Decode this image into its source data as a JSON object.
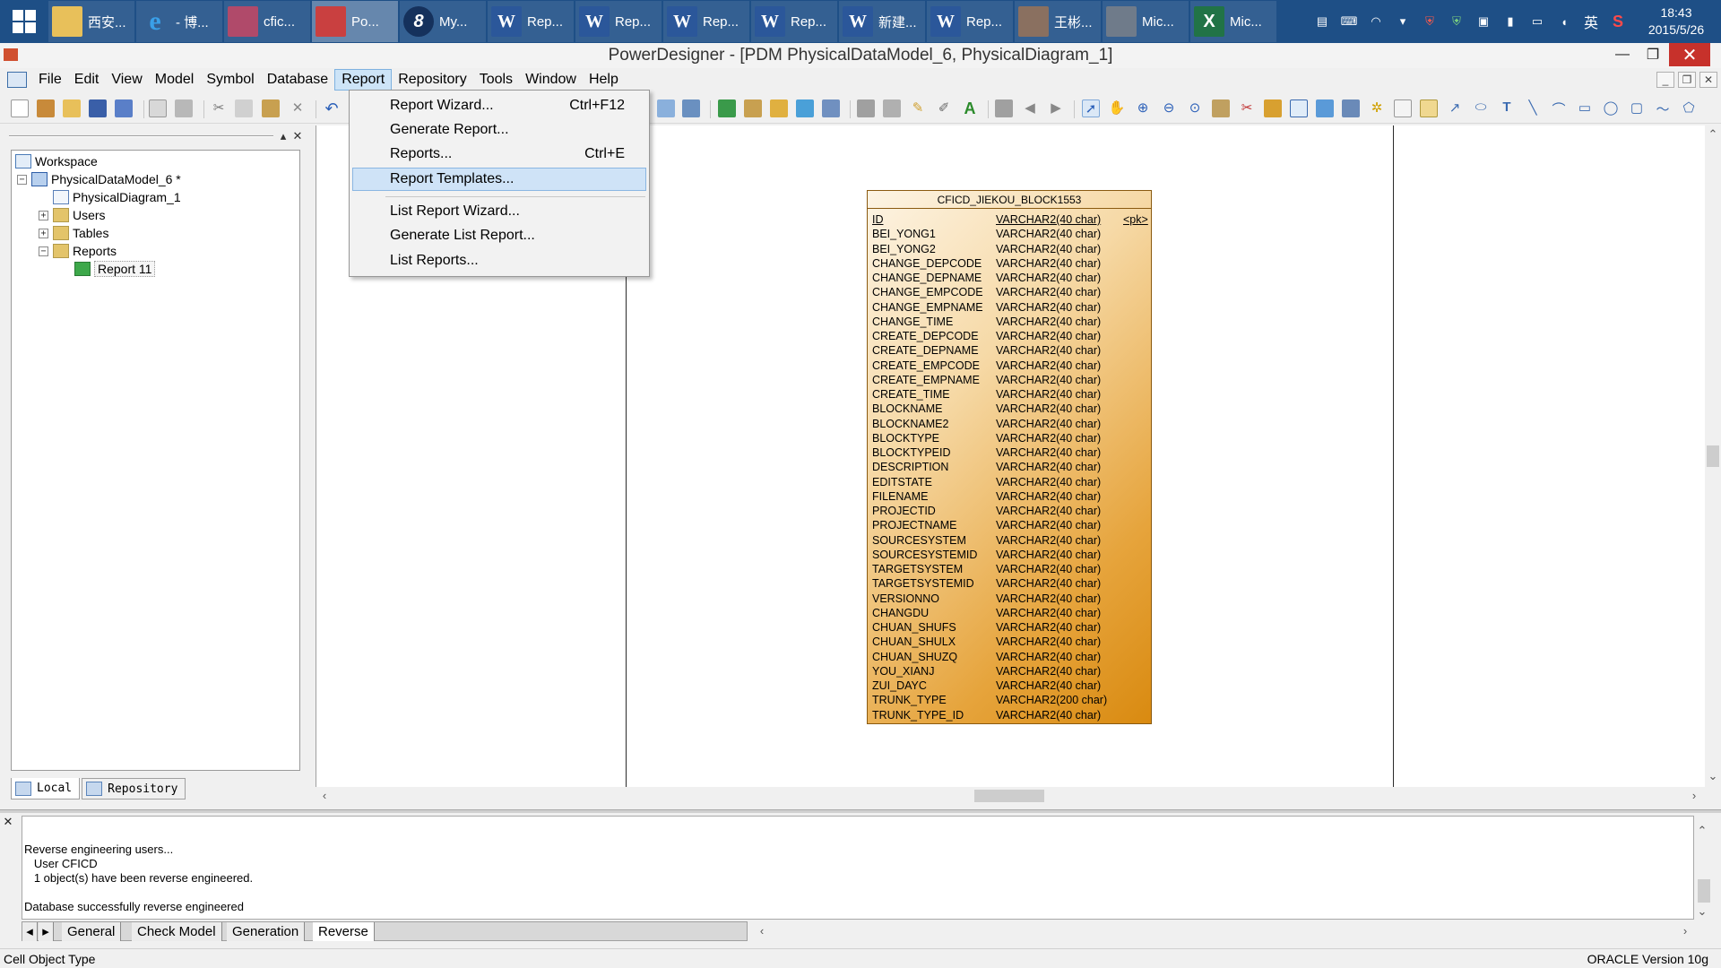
{
  "taskbar": {
    "buttons": [
      {
        "label": "西安...",
        "icon": "folder-icon"
      },
      {
        "label": "- 博...",
        "icon": "ie-icon"
      },
      {
        "label": "cfic...",
        "icon": "database-icon"
      },
      {
        "label": "Po...",
        "icon": "powerdesigner-icon"
      },
      {
        "label": "My...",
        "icon": "myeclipse-icon"
      },
      {
        "label": "Rep...",
        "icon": "word-icon"
      },
      {
        "label": "Rep...",
        "icon": "word-icon"
      },
      {
        "label": "Rep...",
        "icon": "word-icon"
      },
      {
        "label": "Rep...",
        "icon": "word-icon"
      },
      {
        "label": "新建...",
        "icon": "word-icon"
      },
      {
        "label": "Rep...",
        "icon": "word-icon"
      },
      {
        "label": "王彬...",
        "icon": "person-icon"
      },
      {
        "label": "Mic...",
        "icon": "window-icon"
      },
      {
        "label": "Mic...",
        "icon": "excel-icon"
      }
    ],
    "tray": {
      "ime": "英",
      "time": "18:43",
      "date": "2015/5/26"
    }
  },
  "window": {
    "title": "PowerDesigner - [PDM PhysicalDataModel_6, PhysicalDiagram_1]"
  },
  "menubar": {
    "items": [
      "File",
      "Edit",
      "View",
      "Model",
      "Symbol",
      "Database",
      "Report",
      "Repository",
      "Tools",
      "Window",
      "Help"
    ],
    "open_item": "Report"
  },
  "report_menu": {
    "items": [
      {
        "label": "Report Wizard...",
        "shortcut": "Ctrl+F12"
      },
      {
        "label": "Generate Report...",
        "shortcut": ""
      },
      {
        "label": "Reports...",
        "shortcut": "Ctrl+E"
      },
      {
        "label": "Report Templates...",
        "shortcut": ""
      },
      {
        "label": "List Report Wizard...",
        "shortcut": ""
      },
      {
        "label": "Generate List Report...",
        "shortcut": ""
      },
      {
        "label": "List Reports...",
        "shortcut": ""
      }
    ],
    "highlighted": "Report Templates..."
  },
  "browser": {
    "workspace": "Workspace",
    "model": "PhysicalDataModel_6 *",
    "diagram": "PhysicalDiagram_1",
    "users": "Users",
    "tables": "Tables",
    "reports": "Reports",
    "report": "Report 11",
    "tabs": {
      "local": "Local",
      "repository": "Repository"
    }
  },
  "entity": {
    "name": "CFICD_JIEKOU_BLOCK1553",
    "columns": [
      {
        "name": "ID",
        "type": "VARCHAR2(40 char)",
        "key": "<pk>"
      },
      {
        "name": "BEI_YONG1",
        "type": "VARCHAR2(40 char)",
        "key": ""
      },
      {
        "name": "BEI_YONG2",
        "type": "VARCHAR2(40 char)",
        "key": ""
      },
      {
        "name": "CHANGE_DEPCODE",
        "type": "VARCHAR2(40 char)",
        "key": ""
      },
      {
        "name": "CHANGE_DEPNAME",
        "type": "VARCHAR2(40 char)",
        "key": ""
      },
      {
        "name": "CHANGE_EMPCODE",
        "type": "VARCHAR2(40 char)",
        "key": ""
      },
      {
        "name": "CHANGE_EMPNAME",
        "type": "VARCHAR2(40 char)",
        "key": ""
      },
      {
        "name": "CHANGE_TIME",
        "type": "VARCHAR2(40 char)",
        "key": ""
      },
      {
        "name": "CREATE_DEPCODE",
        "type": "VARCHAR2(40 char)",
        "key": ""
      },
      {
        "name": "CREATE_DEPNAME",
        "type": "VARCHAR2(40 char)",
        "key": ""
      },
      {
        "name": "CREATE_EMPCODE",
        "type": "VARCHAR2(40 char)",
        "key": ""
      },
      {
        "name": "CREATE_EMPNAME",
        "type": "VARCHAR2(40 char)",
        "key": ""
      },
      {
        "name": "CREATE_TIME",
        "type": "VARCHAR2(40 char)",
        "key": ""
      },
      {
        "name": "BLOCKNAME",
        "type": "VARCHAR2(40 char)",
        "key": ""
      },
      {
        "name": "BLOCKNAME2",
        "type": "VARCHAR2(40 char)",
        "key": ""
      },
      {
        "name": "BLOCKTYPE",
        "type": "VARCHAR2(40 char)",
        "key": ""
      },
      {
        "name": "BLOCKTYPEID",
        "type": "VARCHAR2(40 char)",
        "key": ""
      },
      {
        "name": "DESCRIPTION",
        "type": "VARCHAR2(40 char)",
        "key": ""
      },
      {
        "name": "EDITSTATE",
        "type": "VARCHAR2(40 char)",
        "key": ""
      },
      {
        "name": "FILENAME",
        "type": "VARCHAR2(40 char)",
        "key": ""
      },
      {
        "name": "PROJECTID",
        "type": "VARCHAR2(40 char)",
        "key": ""
      },
      {
        "name": "PROJECTNAME",
        "type": "VARCHAR2(40 char)",
        "key": ""
      },
      {
        "name": "SOURCESYSTEM",
        "type": "VARCHAR2(40 char)",
        "key": ""
      },
      {
        "name": "SOURCESYSTEMID",
        "type": "VARCHAR2(40 char)",
        "key": ""
      },
      {
        "name": "TARGETSYSTEM",
        "type": "VARCHAR2(40 char)",
        "key": ""
      },
      {
        "name": "TARGETSYSTEMID",
        "type": "VARCHAR2(40 char)",
        "key": ""
      },
      {
        "name": "VERSIONNO",
        "type": "VARCHAR2(40 char)",
        "key": ""
      },
      {
        "name": "CHANGDU",
        "type": "VARCHAR2(40 char)",
        "key": ""
      },
      {
        "name": "CHUAN_SHUFS",
        "type": "VARCHAR2(40 char)",
        "key": ""
      },
      {
        "name": "CHUAN_SHULX",
        "type": "VARCHAR2(40 char)",
        "key": ""
      },
      {
        "name": "CHUAN_SHUZQ",
        "type": "VARCHAR2(40 char)",
        "key": ""
      },
      {
        "name": "YOU_XIANJ",
        "type": "VARCHAR2(40 char)",
        "key": ""
      },
      {
        "name": "ZUI_DAYC",
        "type": "VARCHAR2(40 char)",
        "key": ""
      },
      {
        "name": "TRUNK_TYPE",
        "type": "VARCHAR2(200 char)",
        "key": ""
      },
      {
        "name": "TRUNK_TYPE_ID",
        "type": "VARCHAR2(40 char)",
        "key": ""
      }
    ]
  },
  "output": {
    "lines": [
      "Reverse engineering users...",
      "   User CFICD",
      "   1 object(s) have been reverse engineered.",
      "",
      "Database successfully reverse engineered"
    ],
    "tabs": [
      "General",
      "Check Model",
      "Generation",
      "Reverse"
    ],
    "active_tab": "Reverse"
  },
  "status": {
    "left": "Cell Object Type",
    "right": "ORACLE Version 10g"
  }
}
